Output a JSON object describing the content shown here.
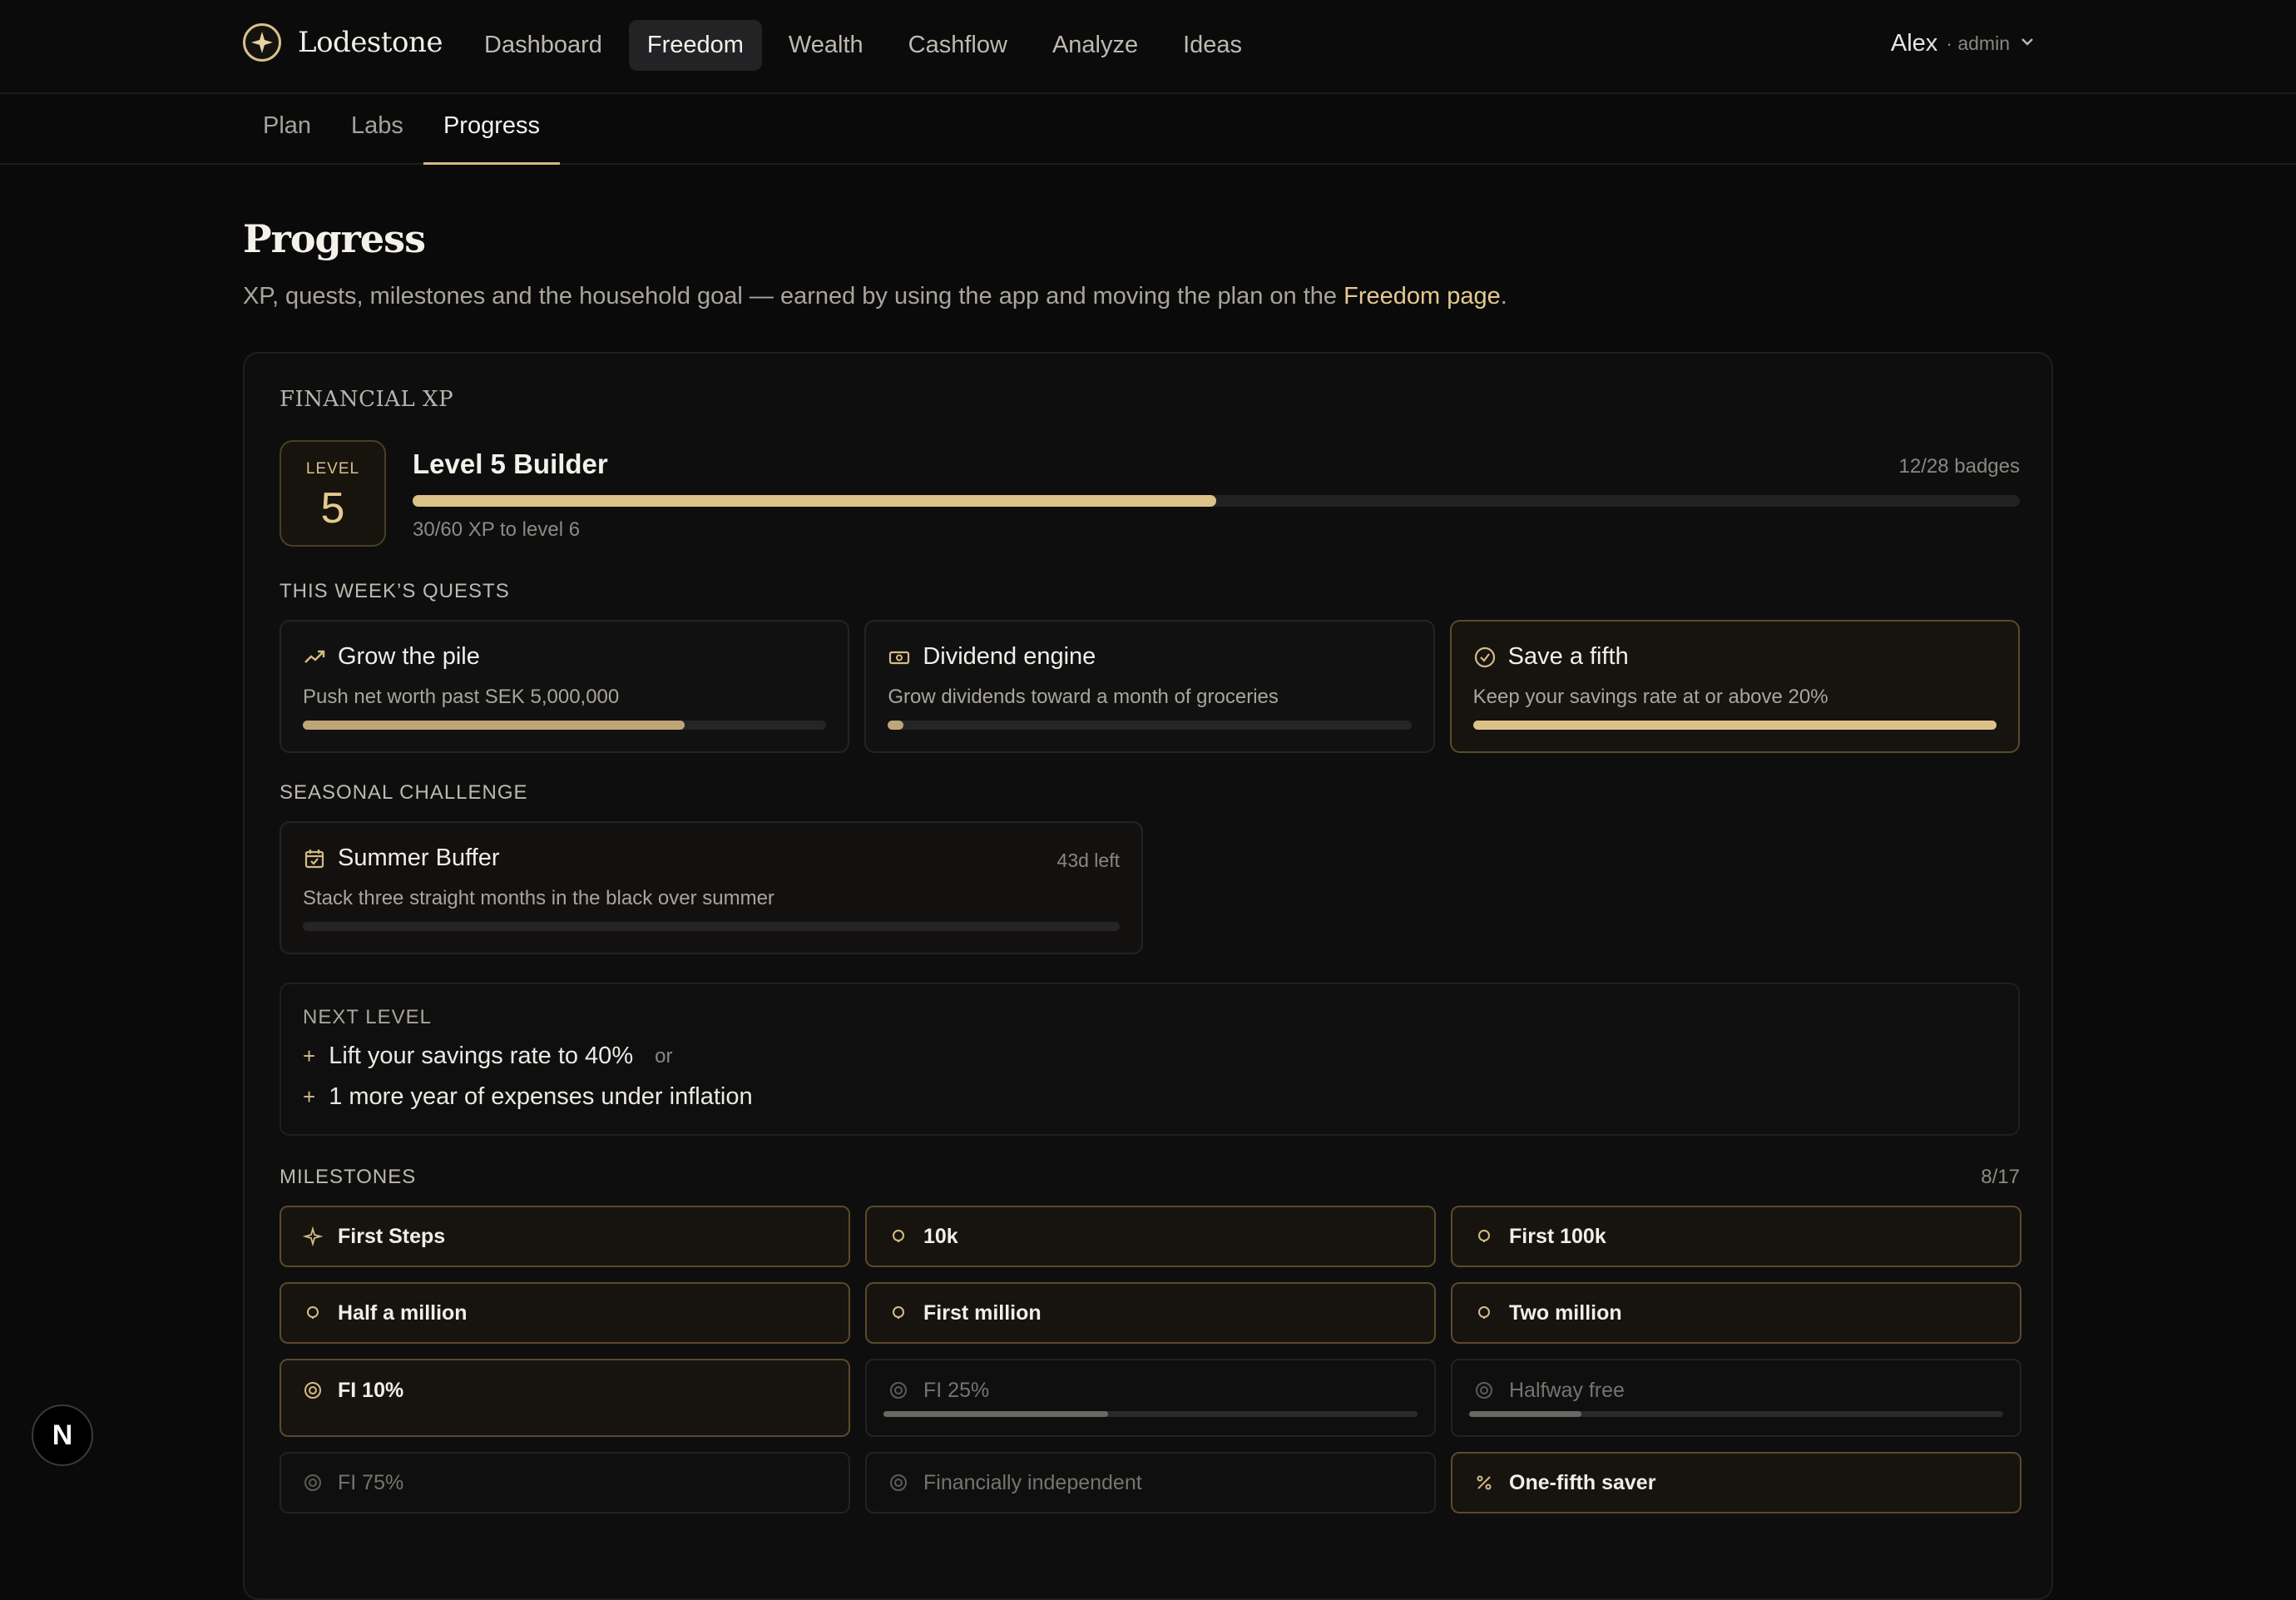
{
  "app": {
    "name": "Lodestone"
  },
  "nav": [
    {
      "label": "Dashboard",
      "active": false
    },
    {
      "label": "Freedom",
      "active": true
    },
    {
      "label": "Wealth",
      "active": false
    },
    {
      "label": "Cashflow",
      "active": false
    },
    {
      "label": "Analyze",
      "active": false
    },
    {
      "label": "Ideas",
      "active": false
    }
  ],
  "user": {
    "name": "Alex",
    "role": "· admin"
  },
  "subtabs": [
    {
      "label": "Plan",
      "active": false
    },
    {
      "label": "Labs",
      "active": false
    },
    {
      "label": "Progress",
      "active": true
    }
  ],
  "page": {
    "title": "Progress",
    "subtitle_prefix": "XP, quests, milestones and the household goal — earned by using the app and moving the plan on the ",
    "subtitle_link": "Freedom page",
    "subtitle_suffix": "."
  },
  "xp": {
    "card_title": "FINANCIAL XP",
    "level_label": "LEVEL",
    "level": "5",
    "level_name": "Level 5 Builder",
    "badges": "12/28 badges",
    "progress_fraction": 0.5,
    "progress_text": "30/60 XP to level 6"
  },
  "quests": {
    "label": "THIS WEEK’S QUESTS",
    "items": [
      {
        "icon": "trend-up-icon",
        "title": "Grow the pile",
        "desc": "Push net worth past SEK 5,000,000",
        "progress": 0.73,
        "done": false
      },
      {
        "icon": "banknote-icon",
        "title": "Dividend engine",
        "desc": "Grow dividends toward a month of groceries",
        "progress": 0.03,
        "done": false
      },
      {
        "icon": "check-circle-icon",
        "title": "Save a fifth",
        "desc": "Keep your savings rate at or above 20%",
        "progress": 1.0,
        "done": true
      }
    ]
  },
  "seasonal": {
    "label": "SEASONAL CHALLENGE",
    "title": "Summer Buffer",
    "desc": "Stack three straight months in the black over summer",
    "days_left": "43d left",
    "progress": 0
  },
  "next_level": {
    "label": "NEXT LEVEL",
    "items": [
      "Lift your savings rate to 40%",
      "1 more year of expenses under inflation"
    ],
    "or": "or"
  },
  "milestones": {
    "label": "MILESTONES",
    "count": "8/17",
    "items": [
      {
        "icon": "sparkle-icon",
        "label": "First Steps",
        "earned": true
      },
      {
        "icon": "coin-icon",
        "label": "10k",
        "earned": true
      },
      {
        "icon": "coin-icon",
        "label": "First 100k",
        "earned": true
      },
      {
        "icon": "coin-icon",
        "label": "Half a million",
        "earned": true
      },
      {
        "icon": "coin-icon",
        "label": "First million",
        "earned": true
      },
      {
        "icon": "coin-icon",
        "label": "Two million",
        "earned": true
      },
      {
        "icon": "target-icon",
        "label": "FI 10%",
        "earned": true
      },
      {
        "icon": "target-icon",
        "label": "FI 25%",
        "earned": false,
        "progress": 0.42
      },
      {
        "icon": "target-icon",
        "label": "Halfway free",
        "earned": false,
        "progress": 0.21
      },
      {
        "icon": "target-icon",
        "label": "FI 75%",
        "earned": false
      },
      {
        "icon": "target-icon",
        "label": "Financially independent",
        "earned": false
      },
      {
        "icon": "percent-icon",
        "label": "One-fifth saver",
        "earned": true
      }
    ]
  },
  "devtools": {
    "label": "N"
  }
}
